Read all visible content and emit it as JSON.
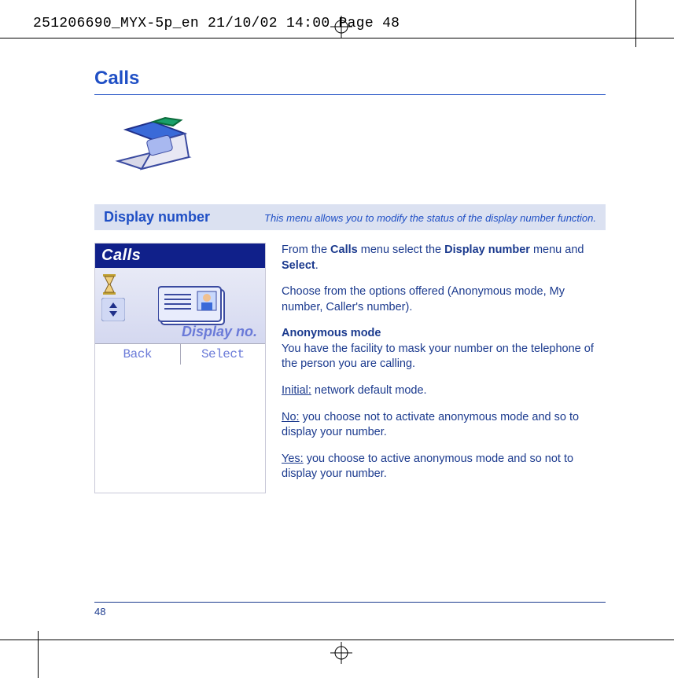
{
  "slug": "251206690_MYX-5p_en  21/10/02  14:00  Page 48",
  "page_title": "Calls",
  "section": {
    "title": "Display number",
    "subtitle": "This menu allows you to modify the status of the display number function."
  },
  "phone": {
    "header": "Calls",
    "menu_item": "Display no.",
    "softkeys": {
      "left": "Back",
      "right": "Select"
    }
  },
  "body": {
    "p1_pre": "From the ",
    "p1_b1": "Calls",
    "p1_mid": " menu select the ",
    "p1_b2": "Display number",
    "p1_mid2": " menu and ",
    "p1_b3": "Select",
    "p1_end": ".",
    "p2": "Choose from the options offered (Anonymous mode, My number, Caller's number).",
    "h_anon": "Anonymous mode",
    "p3": "You have the facility to mask your number on the telephone of the person you are calling.",
    "p4_label": "Initial:",
    "p4_rest": " network default mode.",
    "p5_label": "No:",
    "p5_rest": " you choose not to activate anonymous mode and so to display your number.",
    "p6_label": "Yes:",
    "p6_rest": " you choose to active anonymous mode and so not to display your number."
  },
  "page_number": "48"
}
